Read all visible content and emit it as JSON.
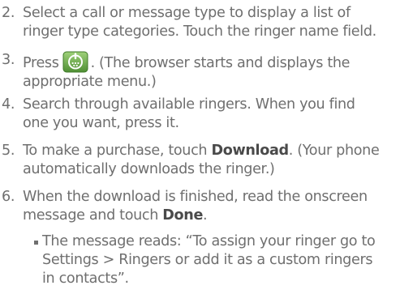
{
  "steps": [
    {
      "number": "2.",
      "lines": [
        "Select a call or message type to display a list of",
        "ringer type categories. Touch the ringer name field."
      ]
    },
    {
      "number": "3.",
      "line1_before": "Press",
      "line1_after": ". (The browser starts and displays the",
      "line2": "appropriate menu.)",
      "icon": "browser-menu-key-icon"
    },
    {
      "number": "4.",
      "lines": [
        "Search through available ringers. When you find",
        "one you want, press it."
      ]
    },
    {
      "number": "5.",
      "line1_before": "To make a purchase, touch ",
      "line1_bold": "Download",
      "line1_after": ". (Your phone",
      "line2": "automatically downloads the ringer.)"
    },
    {
      "number": "6.",
      "line1": "When the download is finished, read the onscreen",
      "line2_before": "message and touch ",
      "line2_bold": "Done",
      "line2_after": "."
    }
  ],
  "bullet": {
    "lines": [
      "The message reads: “To assign your ringer go to",
      "Settings > Ringers or add it as a custom ringers",
      "in contacts”."
    ]
  },
  "colors": {
    "text": "#6f6f6f",
    "bold_text": "#4a4a4a",
    "icon_fill": "#6aa84f"
  }
}
